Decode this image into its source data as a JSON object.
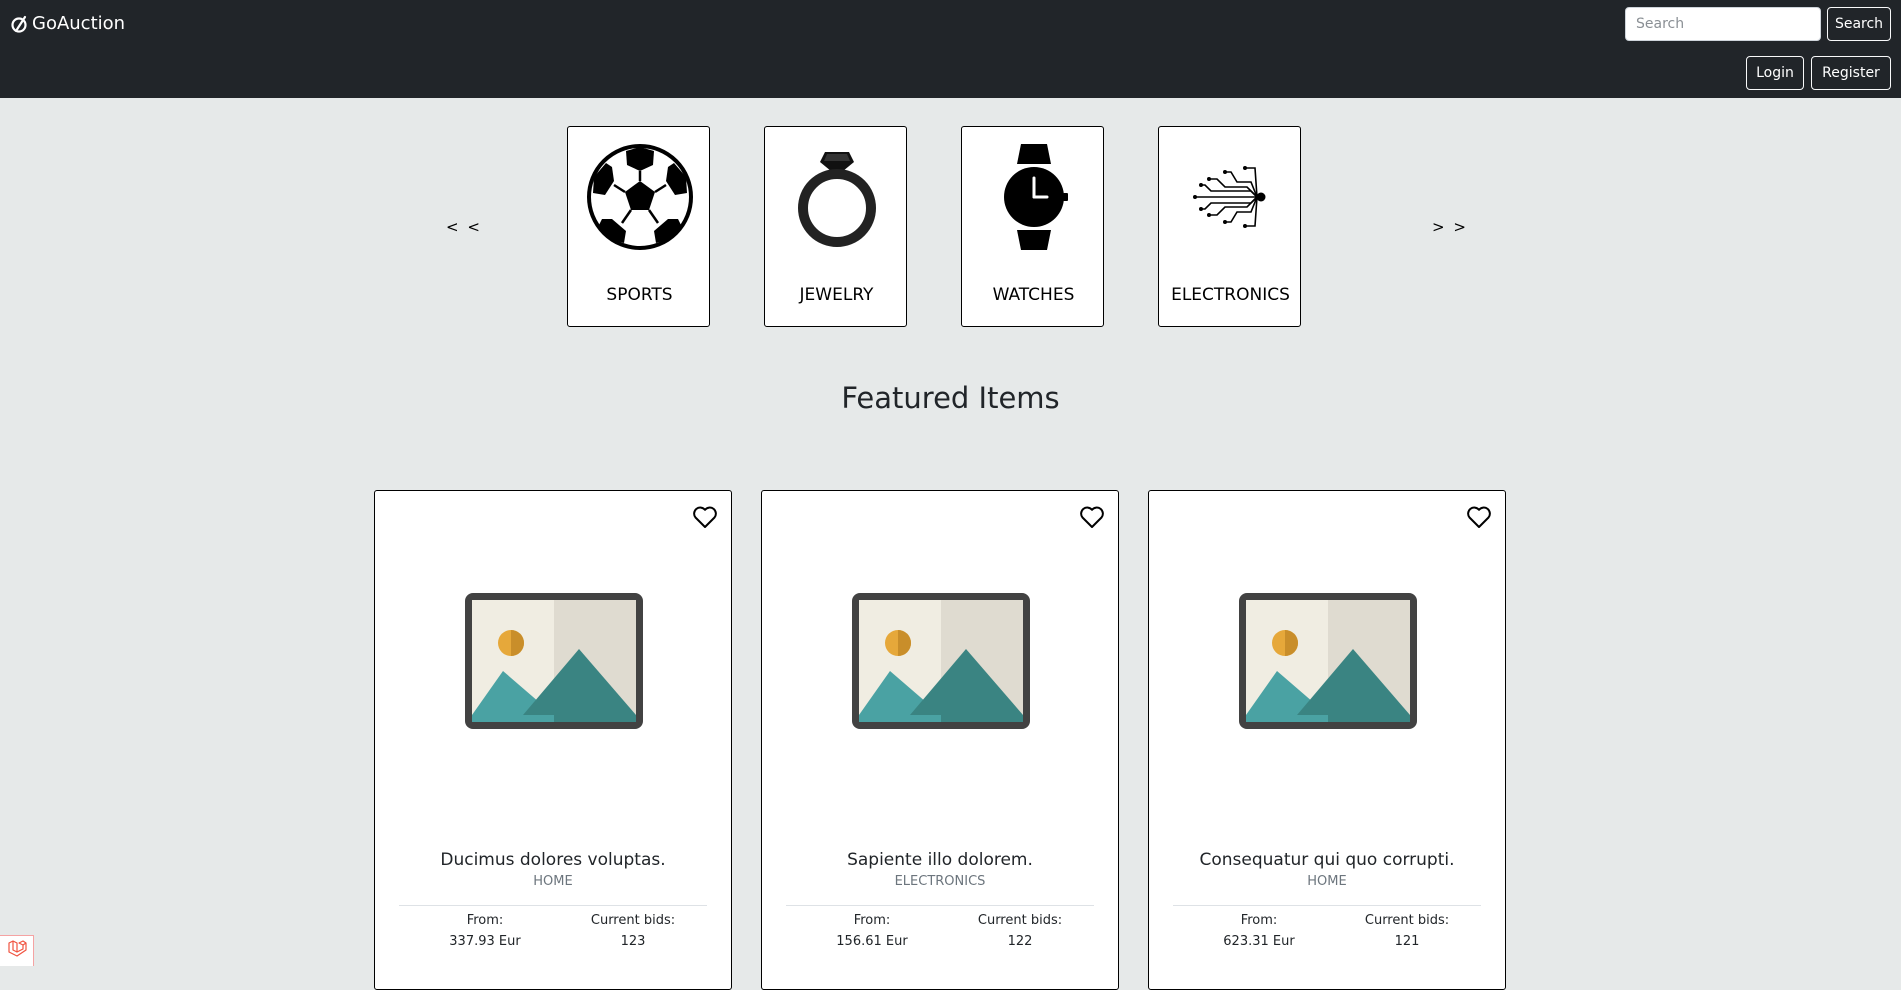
{
  "brand": {
    "name": "GoAuction",
    "logo_icon": "auction-logo-icon"
  },
  "header": {
    "search_placeholder": "Search",
    "search_value": "",
    "search_button": "Search",
    "login_button": "Login",
    "register_button": "Register"
  },
  "categories": {
    "prev_label": "< <",
    "next_label": "> >",
    "items": [
      {
        "label": "SPORTS",
        "icon": "soccer-ball-icon"
      },
      {
        "label": "JEWELRY",
        "icon": "ring-icon"
      },
      {
        "label": "WATCHES",
        "icon": "watch-icon"
      },
      {
        "label": "ELECTRONICS",
        "icon": "circuit-icon"
      }
    ]
  },
  "featured": {
    "title": "Featured Items",
    "from_label": "From:",
    "bids_label": "Current bids:",
    "items": [
      {
        "title": "Ducimus dolores voluptas.",
        "category": "HOME",
        "price": "337.93 Eur",
        "bids": "123",
        "image_icon": "image-placeholder-icon"
      },
      {
        "title": "Sapiente illo dolorem.",
        "category": "ELECTRONICS",
        "price": "156.61 Eur",
        "bids": "122",
        "image_icon": "image-placeholder-icon"
      },
      {
        "title": "Consequatur qui quo corrupti.",
        "category": "HOME",
        "price": "623.31 Eur",
        "bids": "121",
        "image_icon": "image-placeholder-icon"
      }
    ]
  },
  "colors": {
    "navbar": "#212529",
    "page_background": "#e6e9e9",
    "image_sun": "#e6a83a",
    "image_mountain_light": "#4aa2a3",
    "image_mountain_dark": "#3a8482"
  }
}
